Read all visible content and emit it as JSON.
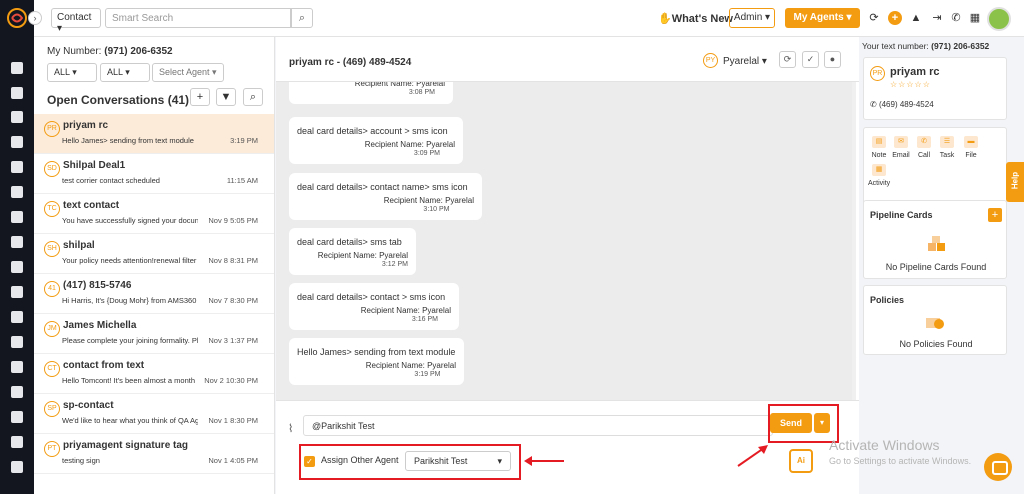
{
  "topbar": {
    "contact_select": "Contact",
    "search_placeholder": "Smart Search",
    "whats_new": "What's New",
    "admin": "Admin",
    "my_agents": "My Agents"
  },
  "left": {
    "my_number_label": "My Number:",
    "my_number": "(971) 206-6352",
    "filter1": "ALL",
    "filter2": "ALL",
    "filter3": "Select Agent",
    "title": "Open Conversations (41)",
    "conversations": [
      {
        "initials": "PR",
        "name": "priyam rc",
        "preview": "Hello James> sending from text module",
        "time": "3:19 PM"
      },
      {
        "initials": "SD",
        "name": "Shilpal Deal1",
        "preview": "test corrier contact scheduled",
        "time": "11:15 AM"
      },
      {
        "initials": "TC",
        "name": "text contact",
        "preview": "You have successfully signed your docun",
        "time": "Nov 9 5:05 PM"
      },
      {
        "initials": "SH",
        "name": "shilpal",
        "preview": "Your policy needs attention!renewal filter",
        "time": "Nov 8 8:31 PM"
      },
      {
        "initials": "41",
        "name": "(417) 815-5746",
        "preview": "Hi Harris, It's {Doug Mohr} from AMS360 in",
        "time": "Nov 7 8:30 PM"
      },
      {
        "initials": "JM",
        "name": "James Michella",
        "preview": "Please complete your joining formality. Pl",
        "time": "Nov 3 1:37 PM"
      },
      {
        "initials": "CT",
        "name": "contact from text",
        "preview": "Hello Tomcont! It's been almost a month",
        "time": "Nov 2 10:30 PM"
      },
      {
        "initials": "SP",
        "name": "sp-contact",
        "preview": "We'd like to hear what you think of QA Age",
        "time": "Nov 1 8:30 PM"
      },
      {
        "initials": "PT",
        "name": "priyamagent signature tag",
        "preview": "testing sign",
        "time": "Nov 1 4:05 PM"
      }
    ]
  },
  "chat": {
    "contact_name": "priyam rc - (469) 489-4524",
    "agent_initials": "PY",
    "agent_name": "Pyarelal",
    "messages": [
      {
        "text": "",
        "recipient": "Recipient Name: Pyarelal",
        "time": "3:08 PM"
      },
      {
        "text": "deal card details> account > sms icon",
        "recipient": "Recipient Name: Pyarelal",
        "time": "3:09 PM"
      },
      {
        "text": "deal card details> contact name> sms icon",
        "recipient": "Recipient Name: Pyarelal",
        "time": "3:10 PM"
      },
      {
        "text": "deal card details> sms tab",
        "recipient": "Recipient Name: Pyarelal",
        "time": "3:12 PM"
      },
      {
        "text": "deal card details> contact > sms icon",
        "recipient": "Recipient Name: Pyarelal",
        "time": "3:16 PM"
      },
      {
        "text": "Hello James> sending from text module",
        "recipient": "Recipient Name: Pyarelal",
        "time": "3:19 PM"
      }
    ],
    "input_value": "@Parikshit Test",
    "send_label": "Send",
    "assign_label": "Assign Other Agent",
    "assign_value": "Parikshit Test",
    "ai_label": "Ai"
  },
  "right": {
    "text_number_label": "Your text number:",
    "text_number": "(971) 206-6352",
    "contact_initials": "PR",
    "contact_name": "priyam rc",
    "contact_phone": "(469) 489-4524",
    "actions": [
      "Note",
      "Email",
      "Call",
      "Task",
      "File",
      "Activity"
    ],
    "pipeline_title": "Pipeline Cards",
    "pipeline_empty": "No Pipeline Cards Found",
    "policies_title": "Policies",
    "policies_empty": "No Policies Found",
    "help": "Help"
  },
  "watermark": {
    "line1": "Activate Windows",
    "line2": "Go to Settings to activate Windows."
  },
  "colors": {
    "accent": "#f39c12",
    "sidebar": "#13151f",
    "annotation_red": "#e41b23"
  }
}
